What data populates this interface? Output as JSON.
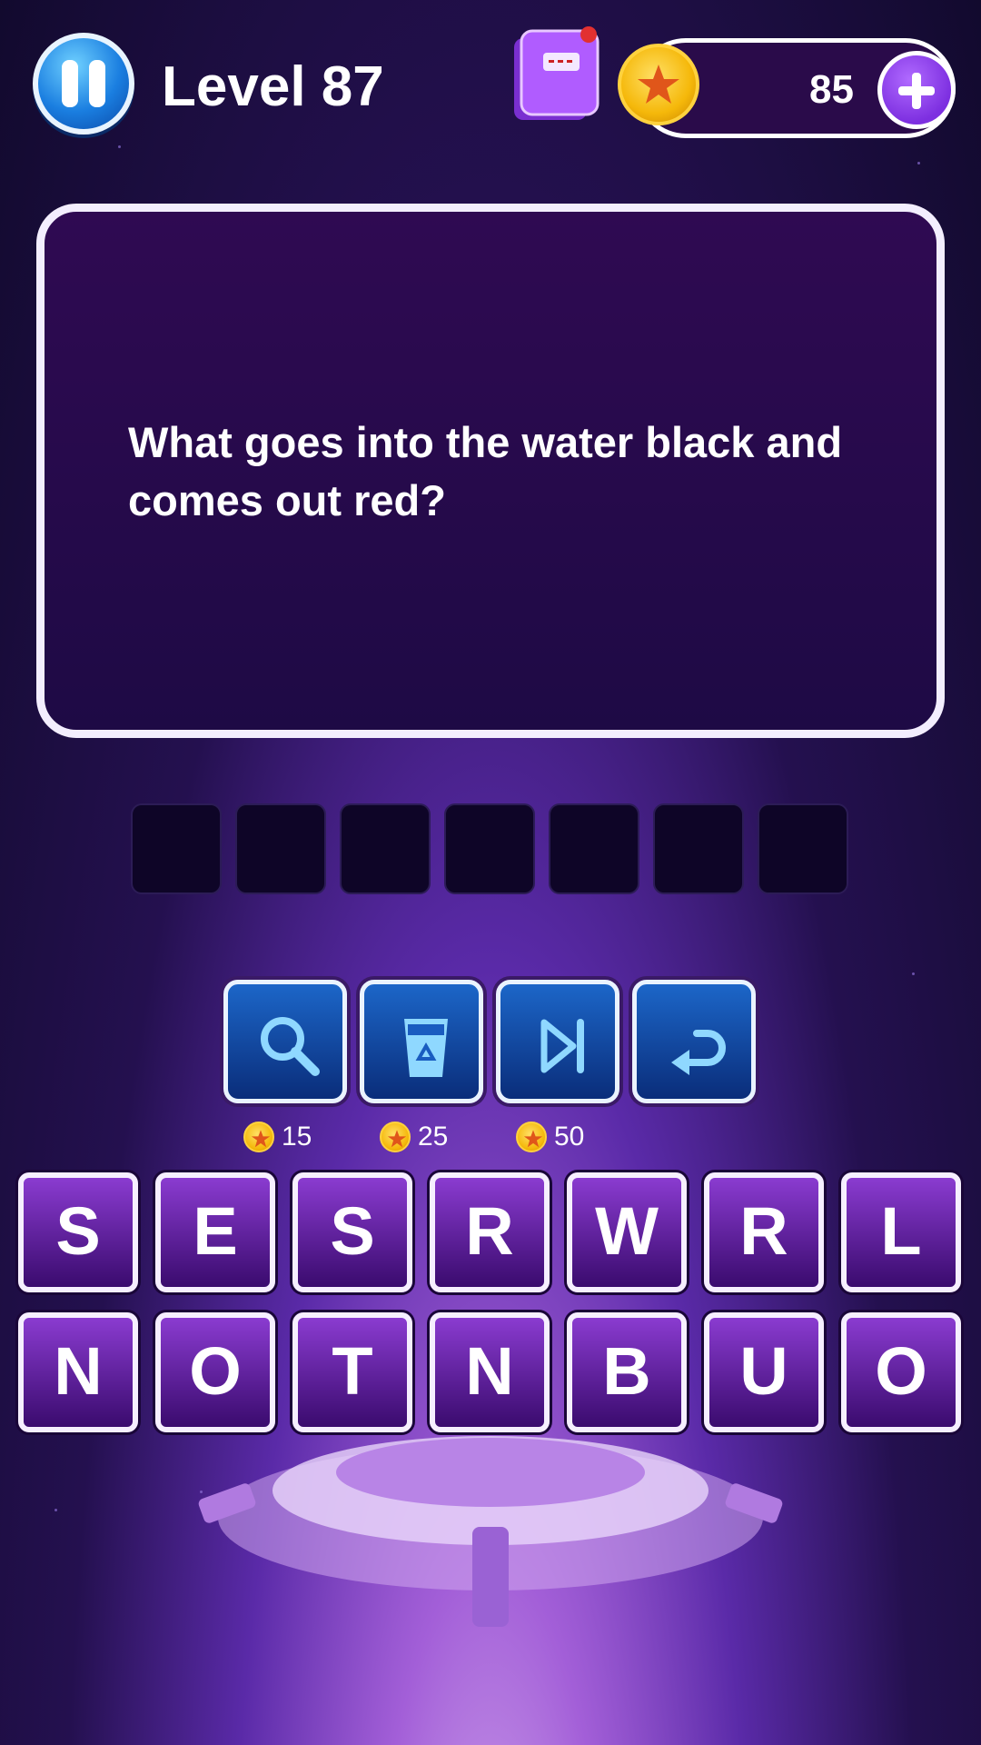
{
  "header": {
    "level_title": "Level 87",
    "coins": "85"
  },
  "question": {
    "text": "What goes into the water black and comes out red?"
  },
  "answer": {
    "slot_count": 7
  },
  "helpers": [
    {
      "name": "reveal-letter",
      "icon": "magnifier-icon",
      "cost": "15"
    },
    {
      "name": "remove-letters",
      "icon": "recycle-bin-icon",
      "cost": "25"
    },
    {
      "name": "skip-level",
      "icon": "skip-icon",
      "cost": "50"
    },
    {
      "name": "undo",
      "icon": "undo-icon",
      "cost": ""
    }
  ],
  "letters": {
    "row1": [
      "S",
      "E",
      "S",
      "R",
      "W",
      "R",
      "L"
    ],
    "row2": [
      "N",
      "O",
      "T",
      "N",
      "B",
      "U",
      "O"
    ]
  },
  "colors": {
    "tile": "#6a22b0",
    "helper": "#1a5cc0",
    "coin": "#f5b80a",
    "accent": "#7d2fe0"
  }
}
